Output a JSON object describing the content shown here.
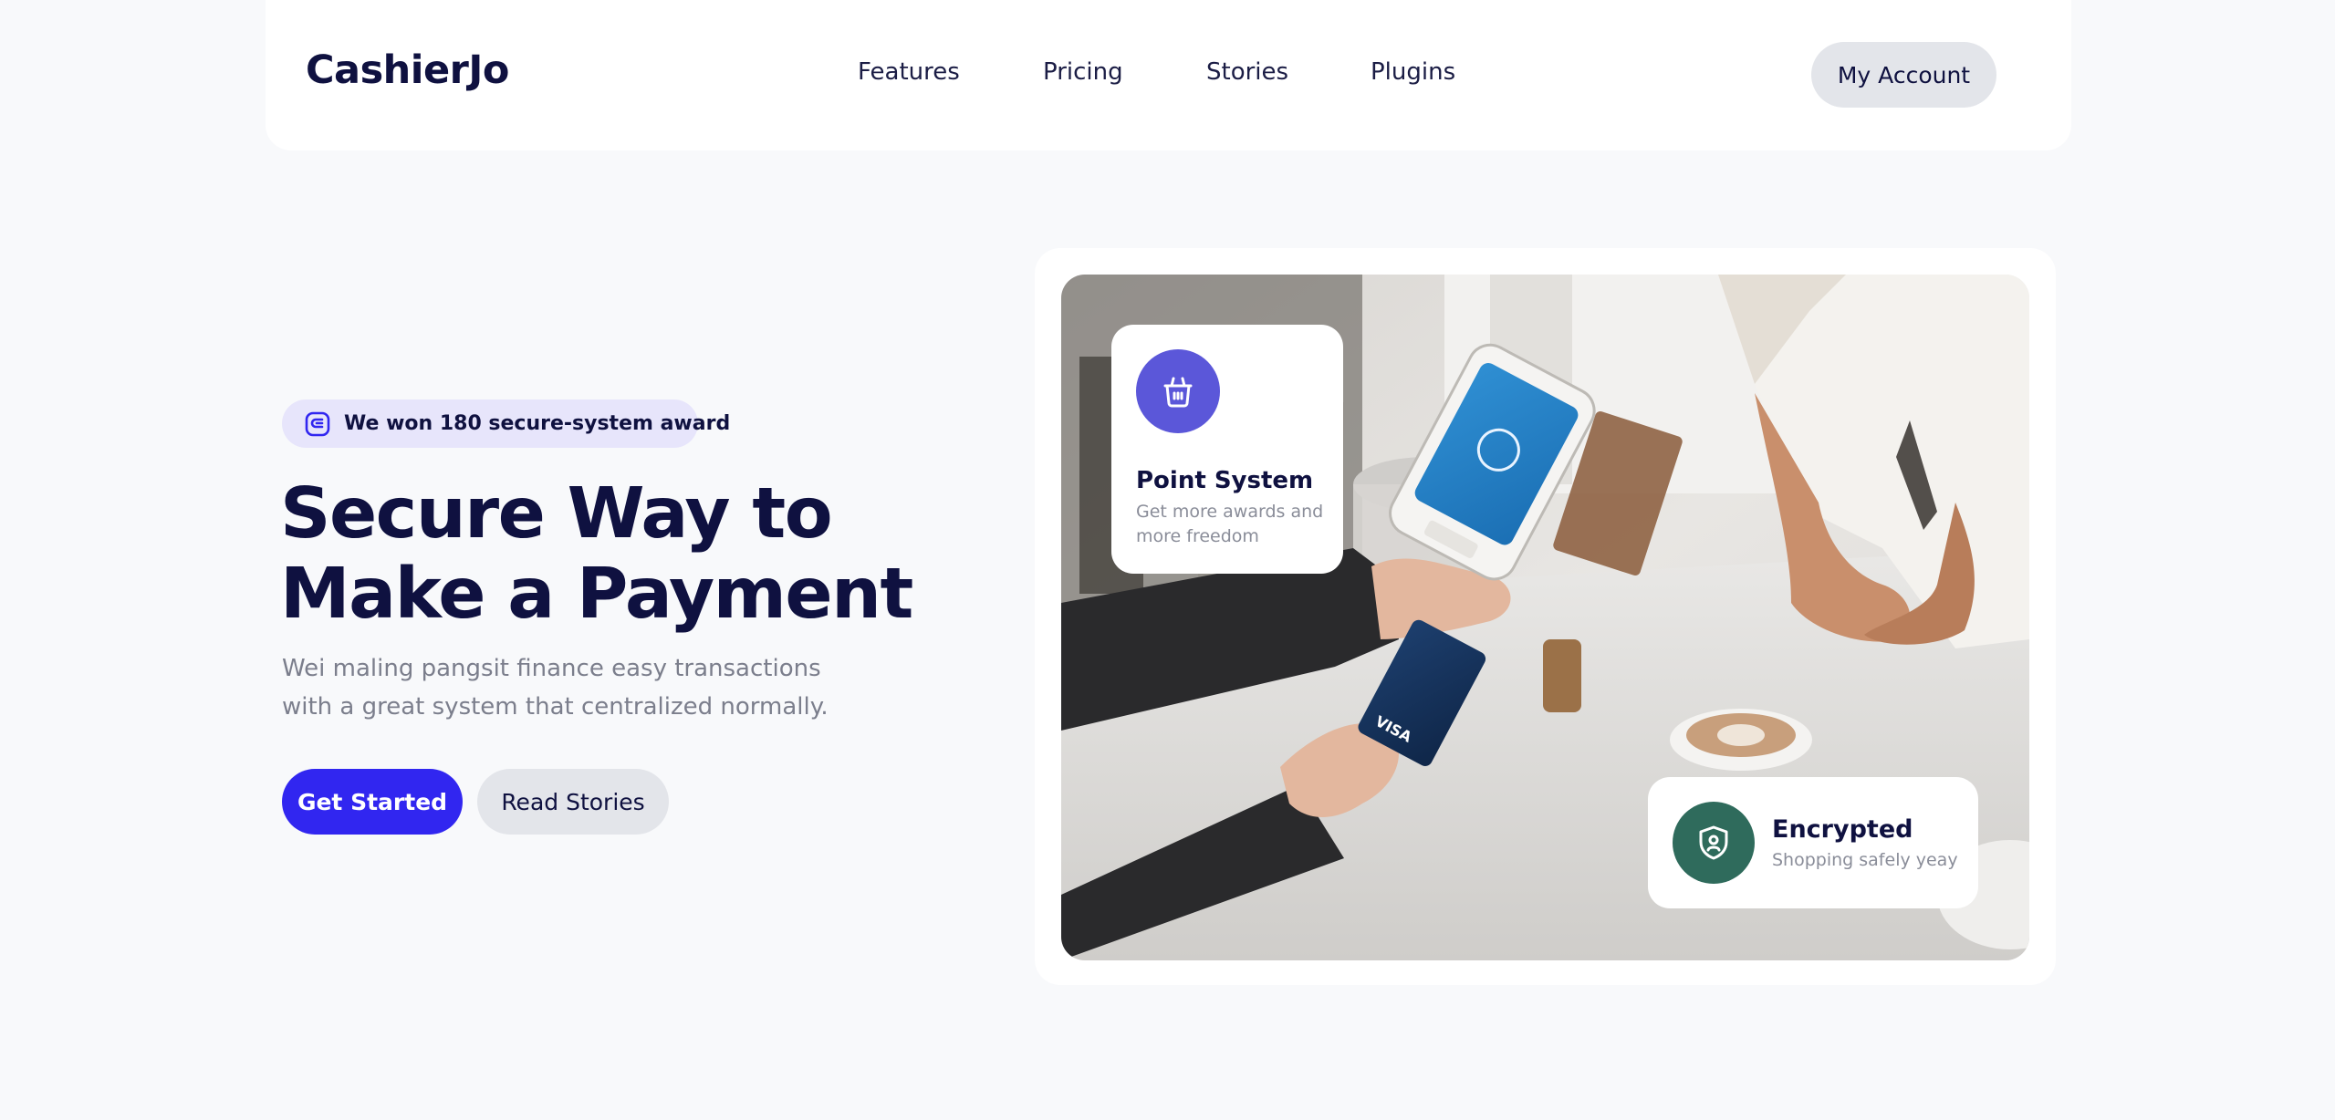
{
  "nav": {
    "logo": "CashierJo",
    "links": [
      "Features",
      "Pricing",
      "Stories",
      "Plugins"
    ],
    "account_label": "My Account"
  },
  "hero": {
    "badge": {
      "icon": "award-icon",
      "text": "We won 180 secure-system award"
    },
    "title_line1": "Secure Way to",
    "title_line2": "Make a Payment",
    "subtitle": "Wei maling pangsit finance easy transactions with a great system that centralized normally.",
    "primary_button": "Get Started",
    "secondary_button": "Read Stories"
  },
  "cards": {
    "point": {
      "icon": "shop-basket-icon",
      "title": "Point System",
      "description": "Get more awards and more freedom"
    },
    "encrypted": {
      "icon": "shield-lock-icon",
      "title": "Encrypted",
      "description": "Shopping safely yeay"
    }
  },
  "colors": {
    "brand_dark": "#0f1140",
    "primary": "#3126f0",
    "badge_bg": "#e7e5fb",
    "point_icon_bg": "#5b57d9",
    "encrypted_icon_bg": "#2f6b5c",
    "page_bg": "#f8f9fb"
  }
}
